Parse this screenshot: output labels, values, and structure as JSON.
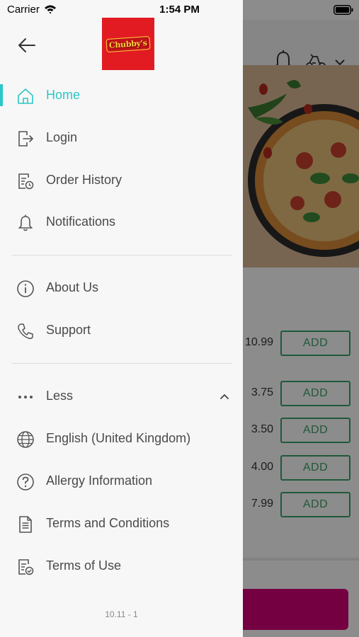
{
  "status_bar": {
    "carrier": "Carrier",
    "time": "1:54 PM"
  },
  "drawer": {
    "logo_text": "Chubby's",
    "menu": [
      {
        "label": "Home",
        "icon": "home-icon",
        "active": true
      },
      {
        "label": "Login",
        "icon": "login-icon"
      },
      {
        "label": "Order History",
        "icon": "order-history-icon"
      },
      {
        "label": "Notifications",
        "icon": "bell-icon"
      },
      {
        "label": "About Us",
        "icon": "info-icon"
      },
      {
        "label": "Support",
        "icon": "phone-icon"
      },
      {
        "label": "Less",
        "icon": "more-dots-icon"
      },
      {
        "label": "English (United Kingdom)",
        "icon": "globe-icon"
      },
      {
        "label": "Allergy Information",
        "icon": "question-icon"
      },
      {
        "label": "Terms and Conditions",
        "icon": "document-icon"
      },
      {
        "label": "Terms of Use",
        "icon": "document-check-icon"
      }
    ],
    "version": "10.11 - 1"
  },
  "background_page": {
    "items": [
      {
        "price": "10.99",
        "button": "ADD"
      },
      {
        "price": "3.75",
        "button": "ADD"
      },
      {
        "price": "3.50",
        "button": "ADD"
      },
      {
        "price": "4.00",
        "button": "ADD"
      },
      {
        "price": "7.99",
        "button": "ADD"
      }
    ]
  },
  "colors": {
    "accent": "#2ac7c7",
    "logo_bg": "#e21b23",
    "add_button": "#3aa36a",
    "cart_bar": "#d40078"
  }
}
